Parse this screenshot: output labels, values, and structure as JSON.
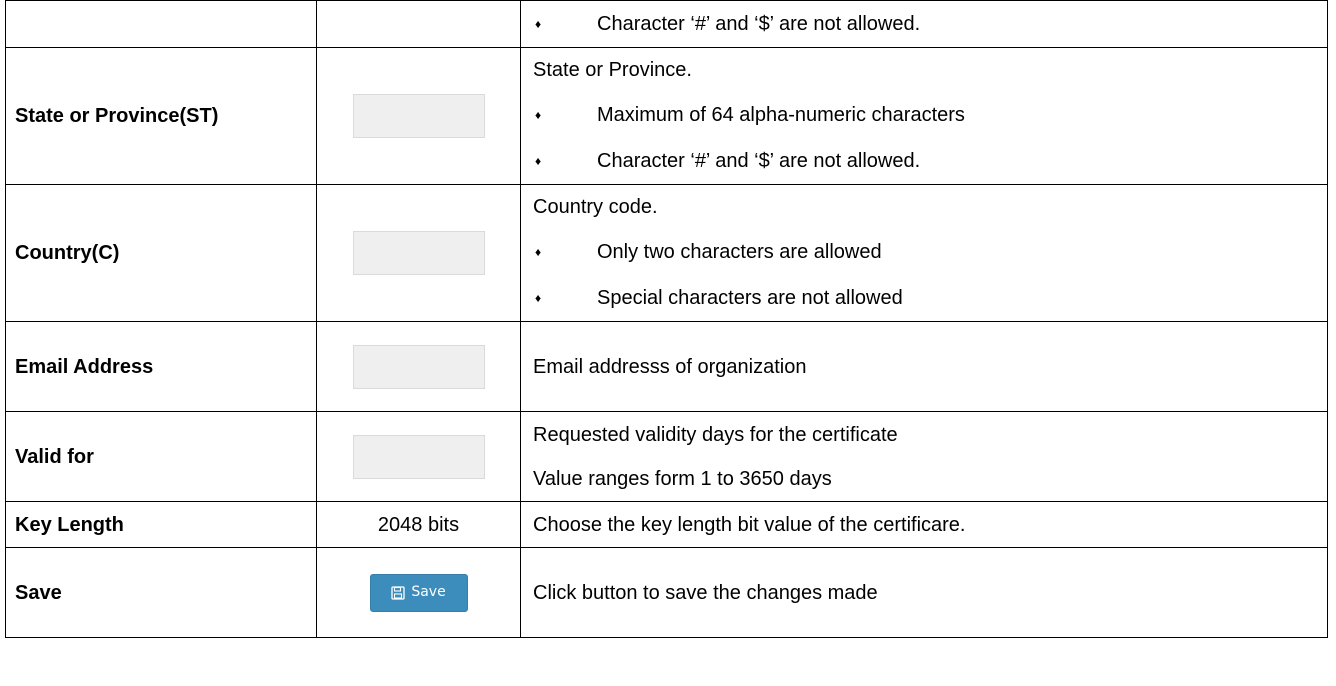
{
  "rows": [
    {
      "label": "",
      "desc_bullets": [
        "Character ‘#’ and ‘$’ are not allowed."
      ]
    },
    {
      "label": "State or Province(ST)",
      "desc_heading": "State or Province.",
      "desc_bullets": [
        "Maximum of 64 alpha-numeric characters",
        "Character ‘#’ and ‘$’ are not allowed."
      ]
    },
    {
      "label": "Country(C)",
      "desc_heading": "Country code.",
      "desc_bullets": [
        "Only two characters are allowed",
        "Special characters are not allowed"
      ]
    },
    {
      "label": "Email Address",
      "desc_lines": [
        "Email addresss of organization"
      ]
    },
    {
      "label": "Valid for",
      "desc_lines": [
        "Requested validity days for the certificate",
        "Value ranges form 1 to 3650 days"
      ]
    },
    {
      "label": "Key Length",
      "value": "2048 bits",
      "desc_lines": [
        "Choose the key length bit value of the certificare."
      ]
    },
    {
      "label": "Save",
      "button_label": "Save",
      "button_icon": "floppy-disk-icon",
      "desc_lines": [
        "Click button to save the changes made"
      ]
    }
  ],
  "bullet_glyph": "♦",
  "colors": {
    "button_bg": "#3c8dbc",
    "field_bg": "#efefef",
    "border": "#000000"
  }
}
